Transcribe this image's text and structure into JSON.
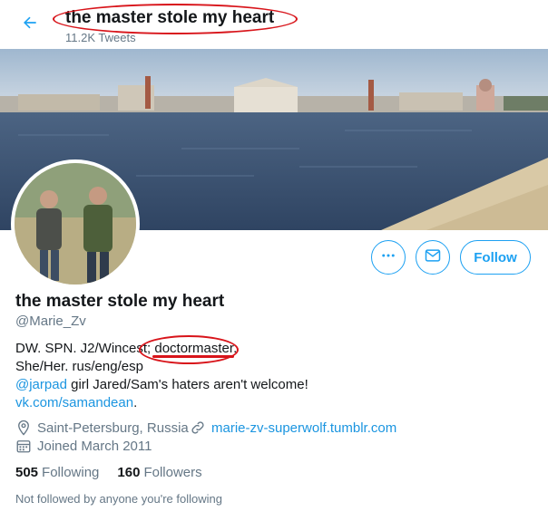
{
  "header": {
    "title": "the master stole my heart",
    "tweet_count": "11.2K Tweets"
  },
  "profile": {
    "display_name": "the master stole my heart",
    "handle": "@Marie_Zv",
    "bio": {
      "line1": "DW. SPN. J2/Wincest; doctormaster.",
      "line2": "She/Her. rus/eng/esp",
      "mention": "@jarpad",
      "line3_rest": " girl Jared/Sam's haters aren't welcome!",
      "link": "vk.com/samandean",
      "link_suffix": "."
    },
    "location": "Saint-Petersburg, Russia",
    "website": "marie-zv-superwolf.tumblr.com",
    "joined": "Joined March 2011"
  },
  "stats": {
    "following_count": "505",
    "following_label": "Following",
    "followers_count": "160",
    "followers_label": "Followers"
  },
  "actions": {
    "follow_label": "Follow"
  },
  "followers_note": "Not followed by anyone you're following",
  "colors": {
    "accent": "#1da1f2",
    "annotation": "#d8141a",
    "muted": "#657786"
  },
  "icons": [
    "back-arrow-icon",
    "more-icon",
    "mail-icon",
    "location-icon",
    "link-icon",
    "calendar-icon"
  ]
}
